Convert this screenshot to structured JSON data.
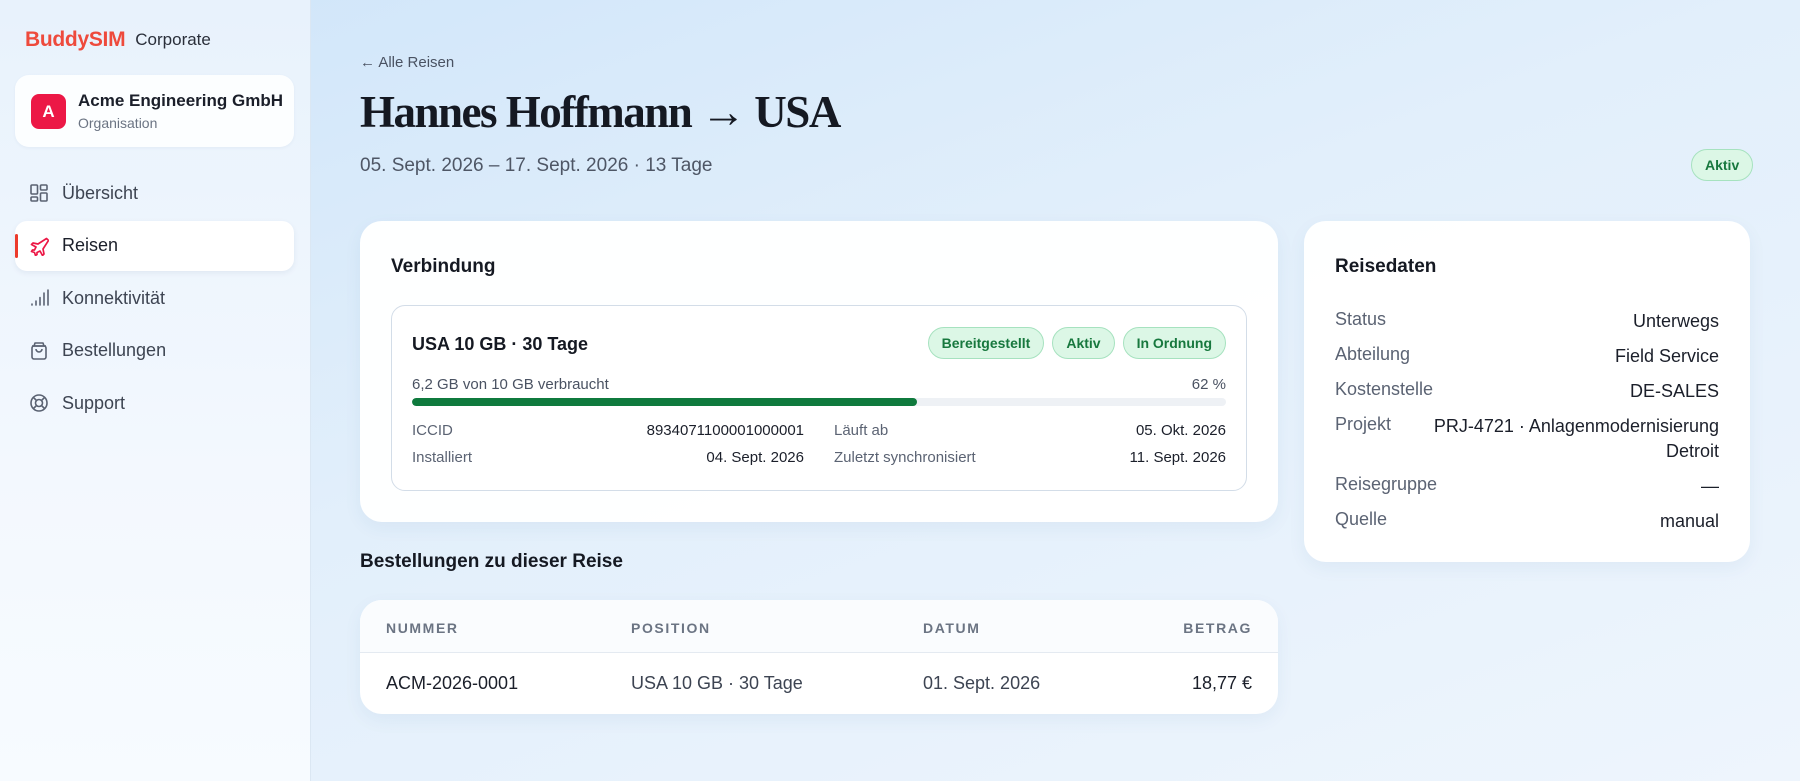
{
  "brand": {
    "logo_text": "BuddySIM",
    "product": "Corporate"
  },
  "organization": {
    "avatar_letter": "A",
    "name": "Acme Engineering GmbH",
    "role": "Organisation"
  },
  "nav": {
    "items": [
      {
        "label": "Übersicht",
        "icon": "grid-icon",
        "active": false
      },
      {
        "label": "Reisen",
        "icon": "airplane-icon",
        "active": true
      },
      {
        "label": "Konnektivität",
        "icon": "signal-bars-icon",
        "active": false
      },
      {
        "label": "Bestellungen",
        "icon": "shopping-bag-icon",
        "active": false
      },
      {
        "label": "Support",
        "icon": "lifebuoy-icon",
        "active": false
      }
    ]
  },
  "header": {
    "back_link": "← Alle Reisen",
    "title": "Hannes Hoffmann → USA",
    "subtitle": "05. Sept. 2026 – 17. Sept. 2026 · 13 Tage",
    "status_badge": "Aktiv"
  },
  "connection": {
    "title": "Verbindung",
    "plan_name": "USA 10 GB · 30 Tage",
    "badges": [
      "Bereitgestellt",
      "Aktiv",
      "In Ordnung"
    ],
    "usage_label": "6,2 GB von 10 GB verbraucht",
    "usage_percent_label": "62 %",
    "usage_fraction": 0.62,
    "details": {
      "iccid_label": "ICCID",
      "iccid_value": "8934071100001000001",
      "expires_label": "Läuft ab",
      "expires_value": "05. Okt. 2026",
      "installed_label": "Installiert",
      "installed_value": "04. Sept. 2026",
      "synced_label": "Zuletzt synchronisiert",
      "synced_value": "11. Sept. 2026"
    }
  },
  "orders": {
    "title": "Bestellungen zu dieser Reise",
    "columns": [
      "NUMMER",
      "POSITION",
      "DATUM",
      "BETRAG"
    ],
    "rows": [
      {
        "number": "ACM-2026-0001",
        "position": "USA 10 GB · 30 Tage",
        "date": "01. Sept. 2026",
        "amount": "18,77 €"
      }
    ]
  },
  "trip_data": {
    "title": "Reisedaten",
    "rows": [
      {
        "label": "Status",
        "value": "Unterwegs"
      },
      {
        "label": "Abteilung",
        "value": "Field Service"
      },
      {
        "label": "Kostenstelle",
        "value": "DE-SALES"
      },
      {
        "label": "Projekt",
        "value_line1": "PRJ-4721 · Anlagenmodernisierung",
        "value_line2": "Detroit"
      },
      {
        "label": "Reisegruppe",
        "value": "—"
      },
      {
        "label": "Quelle",
        "value": "manual"
      }
    ]
  },
  "colors": {
    "accent_red": "#ec3a2b",
    "org_avatar": "#ec1846",
    "success_green": "#0f7a3d",
    "badge_bg": "#dcf7e6"
  }
}
